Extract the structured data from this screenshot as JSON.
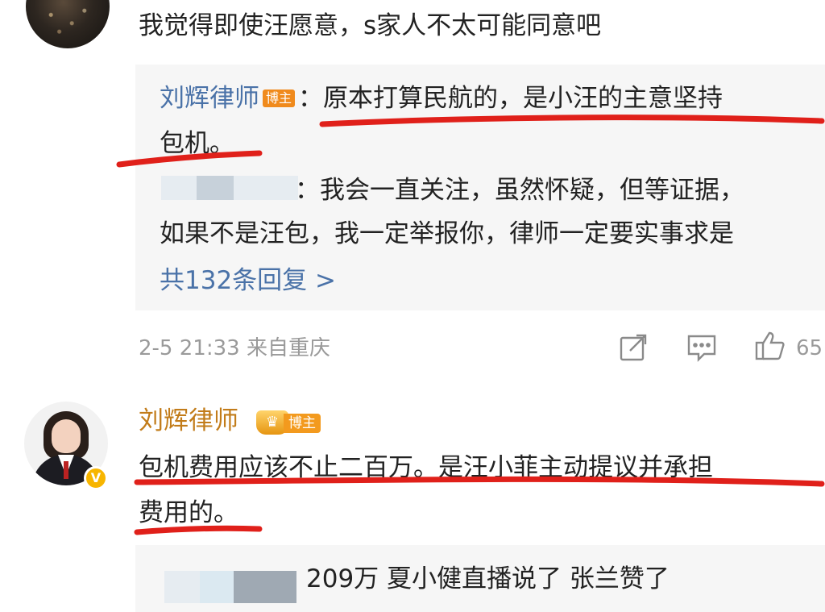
{
  "comment1": {
    "text": "我觉得即使汪愿意，s家人不太可能同意吧"
  },
  "reply_block1": {
    "reply1": {
      "author": "刘辉律师",
      "badge": "博主",
      "separator": "：",
      "line1": "原本打算民航的，是小汪的主意坚持",
      "line2": "包机。"
    },
    "reply2": {
      "line1": "：我会一直关注，虽然怀疑，但等证据，",
      "line2": "如果不是汪包，我一定举报你，律师一定要实事求是"
    },
    "more_replies": "共132条回复 >"
  },
  "comment1_meta": {
    "time": "2-5 21:33",
    "source": "来自重庆",
    "likes": "65",
    "icons": [
      "share-icon",
      "comment-icon",
      "like-icon"
    ]
  },
  "comment2": {
    "author": "刘辉律师",
    "badge": "博主",
    "verified_mark": "V",
    "line1": "包机费用应该不止二百万。是汪小菲主动提议并承担",
    "line2": "费用的。"
  },
  "reply_block2": {
    "text": "209万 夏小健直播说了 张兰赞了"
  },
  "colors": {
    "author_name": "#c27c1a",
    "reply_author": "#4a72a8",
    "underline_red": "#e0201a",
    "badge_orange": "#f08a1c",
    "reply_bg": "#f6f6f6"
  }
}
